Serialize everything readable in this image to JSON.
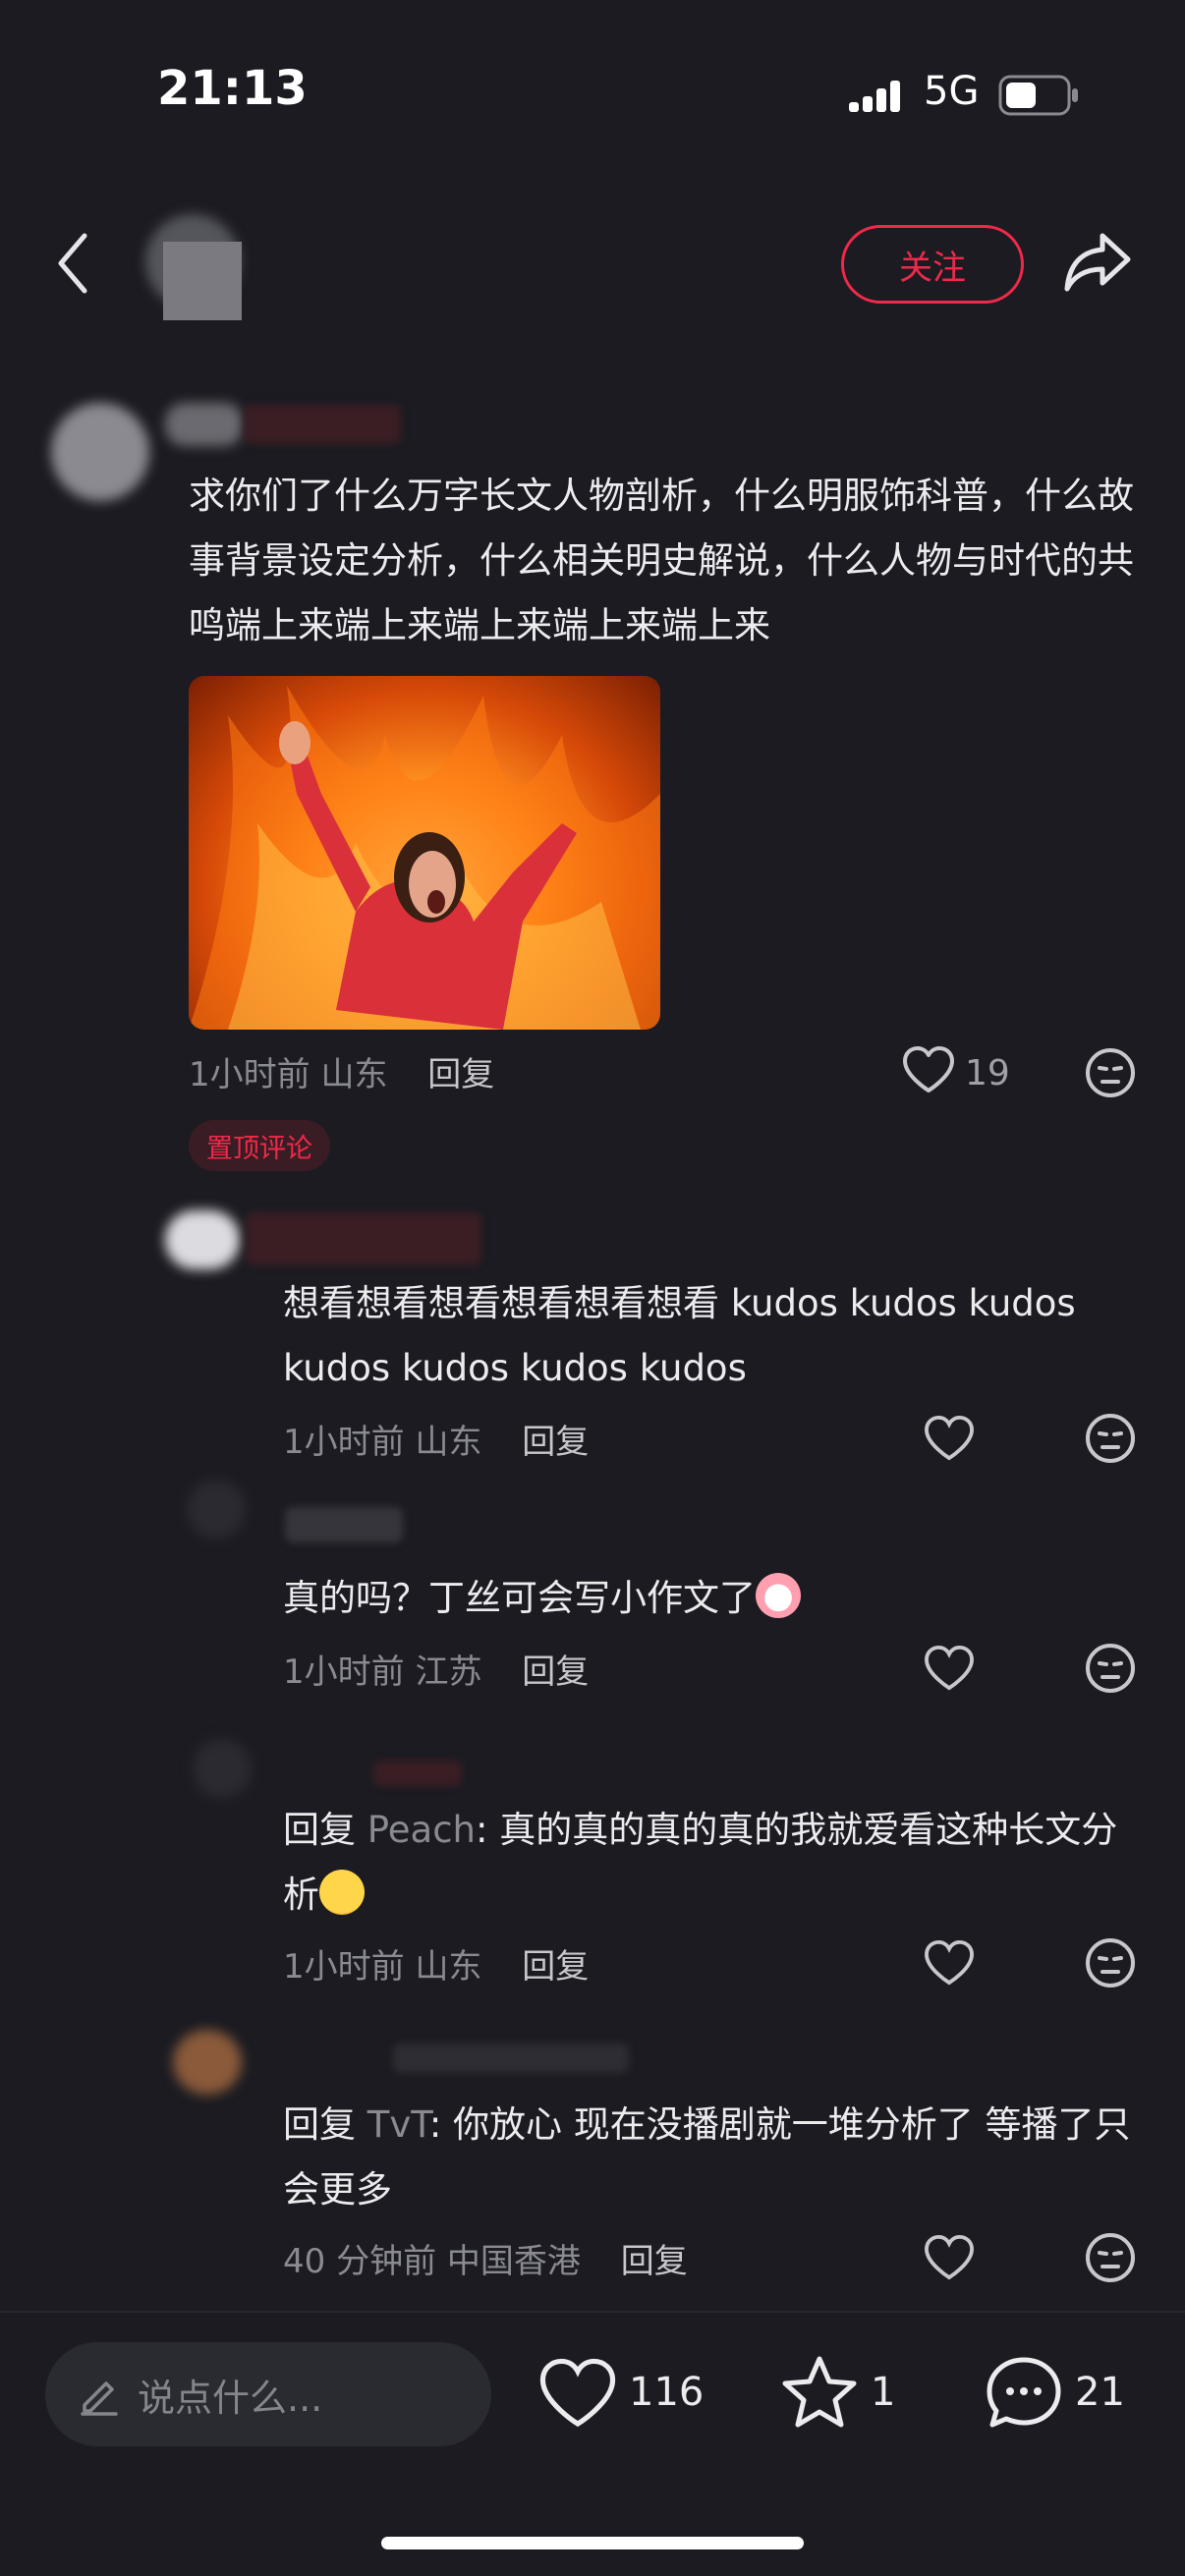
{
  "status_bar": {
    "time": "21:13",
    "network": "5G"
  },
  "header": {
    "follow_label": "关注"
  },
  "main_comment": {
    "text": "求你们了什么万字长文人物剖析，什么明服饰科普，什么故事背景设定分析，什么相关明史解说，什么人物与时代的共鸣端上来端上来端上来端上来端上来",
    "time": "1小时前",
    "location": "山东",
    "reply_label": "回复",
    "likes": "19",
    "pinned_label": "置顶评论"
  },
  "replies": [
    {
      "text": "想看想看想看想看想看想看 kudos kudos kudos kudos kudos kudos kudos",
      "time": "1小时前",
      "location": "山东",
      "reply_label": "回复"
    },
    {
      "text": "真的吗？丁丝可会写小作文了",
      "time": "1小时前",
      "location": "江苏",
      "reply_label": "回复"
    },
    {
      "prefix": "回复",
      "to": "Peach",
      "text": ": 真的真的真的真的我就爱看这种长文分析",
      "time": "1小时前",
      "location": "山东",
      "reply_label": "回复"
    },
    {
      "prefix": "回复",
      "to": "TvT",
      "text": ": 你放心 现在没播剧就一堆分析了 等播了只会更多",
      "time": "40 分钟前",
      "location": "中国香港",
      "reply_label": "回复"
    }
  ],
  "bottom_bar": {
    "input_placeholder": "说点什么...",
    "likes": "116",
    "stars": "1",
    "comments": "21"
  },
  "icons": [
    "back-icon",
    "share-icon",
    "heart-icon",
    "sad-face-icon",
    "edit-icon",
    "star-icon",
    "comment-icon",
    "signal-icon",
    "battery-icon"
  ],
  "colors": {
    "accent": "#f0294a",
    "background": "#1b1b21"
  }
}
